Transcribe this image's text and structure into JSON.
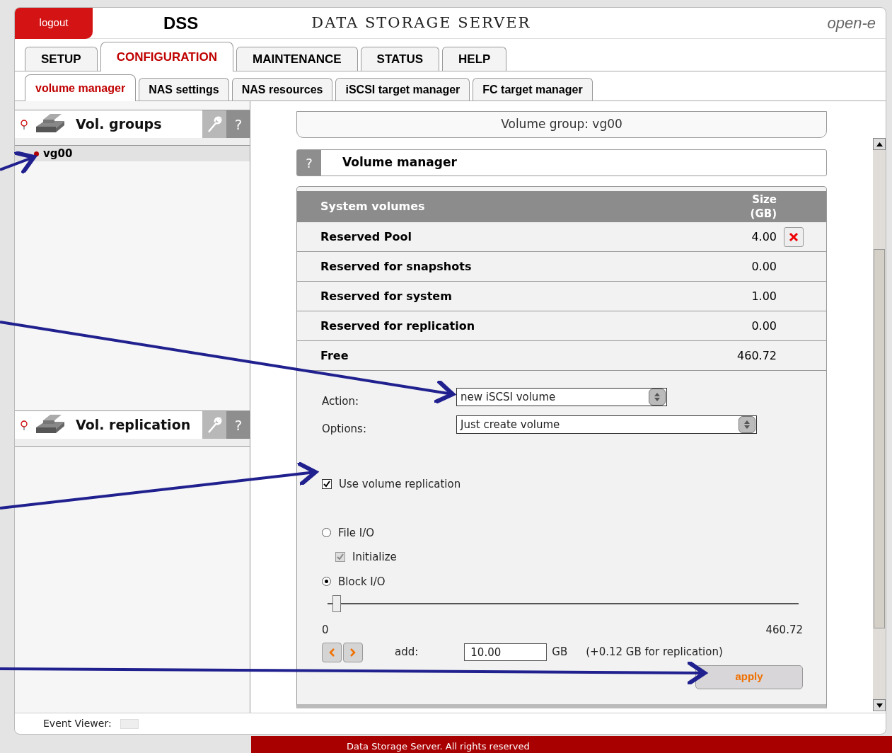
{
  "header": {
    "logout": "logout",
    "logo": "DSS",
    "title": "DATA STORAGE SERVER",
    "brand": "open-e"
  },
  "tabs": [
    {
      "label": "SETUP",
      "selected": false
    },
    {
      "label": "CONFIGURATION",
      "selected": true
    },
    {
      "label": "MAINTENANCE",
      "selected": false
    },
    {
      "label": "STATUS",
      "selected": false
    },
    {
      "label": "HELP",
      "selected": false
    }
  ],
  "subtabs": [
    {
      "label": "volume manager",
      "selected": true
    },
    {
      "label": "NAS settings",
      "selected": false
    },
    {
      "label": "NAS resources",
      "selected": false
    },
    {
      "label": "iSCSI target manager",
      "selected": false
    },
    {
      "label": "FC target manager",
      "selected": false
    }
  ],
  "sidebar": [
    {
      "title": "Vol. groups",
      "help": "?",
      "items": [
        {
          "label": "vg00",
          "selected": true
        }
      ]
    },
    {
      "title": "Vol. replication",
      "help": "?"
    }
  ],
  "main": {
    "group_title": "Volume group: vg00",
    "section_help": "?",
    "section_title": "Volume manager",
    "table": {
      "columns": [
        "System volumes",
        "Size\n(GB)"
      ],
      "rows": [
        {
          "name": "Reserved Pool",
          "size": "4.00",
          "removable": true
        },
        {
          "name": "Reserved for snapshots",
          "size": "0.00",
          "removable": false
        },
        {
          "name": "Reserved for system",
          "size": "1.00",
          "removable": false
        },
        {
          "name": "Reserved for replication",
          "size": "0.00",
          "removable": false
        },
        {
          "name": "Free",
          "size": "460.72",
          "removable": false
        }
      ]
    },
    "action": {
      "label": "Action:",
      "value": "new iSCSI volume"
    },
    "options": {
      "label": "Options:",
      "value": "Just create volume"
    },
    "replication": {
      "label": "Use volume replication",
      "checked": true
    },
    "io_types": [
      {
        "label": "File I/O",
        "selected": false
      },
      {
        "label": "Block I/O",
        "selected": true
      }
    ],
    "initialize": {
      "label": "Initialize",
      "checked": true,
      "disabled": true
    },
    "slider": {
      "level": 0.02,
      "min": "0",
      "max": "460.72"
    },
    "add": {
      "label": "add:",
      "value": "10.00",
      "unit": "GB",
      "note": "(+0.12 GB for replication)"
    },
    "apply": "apply"
  },
  "event_viewer": "Event Viewer:",
  "footer": "Data Storage Server. All rights reserved"
}
